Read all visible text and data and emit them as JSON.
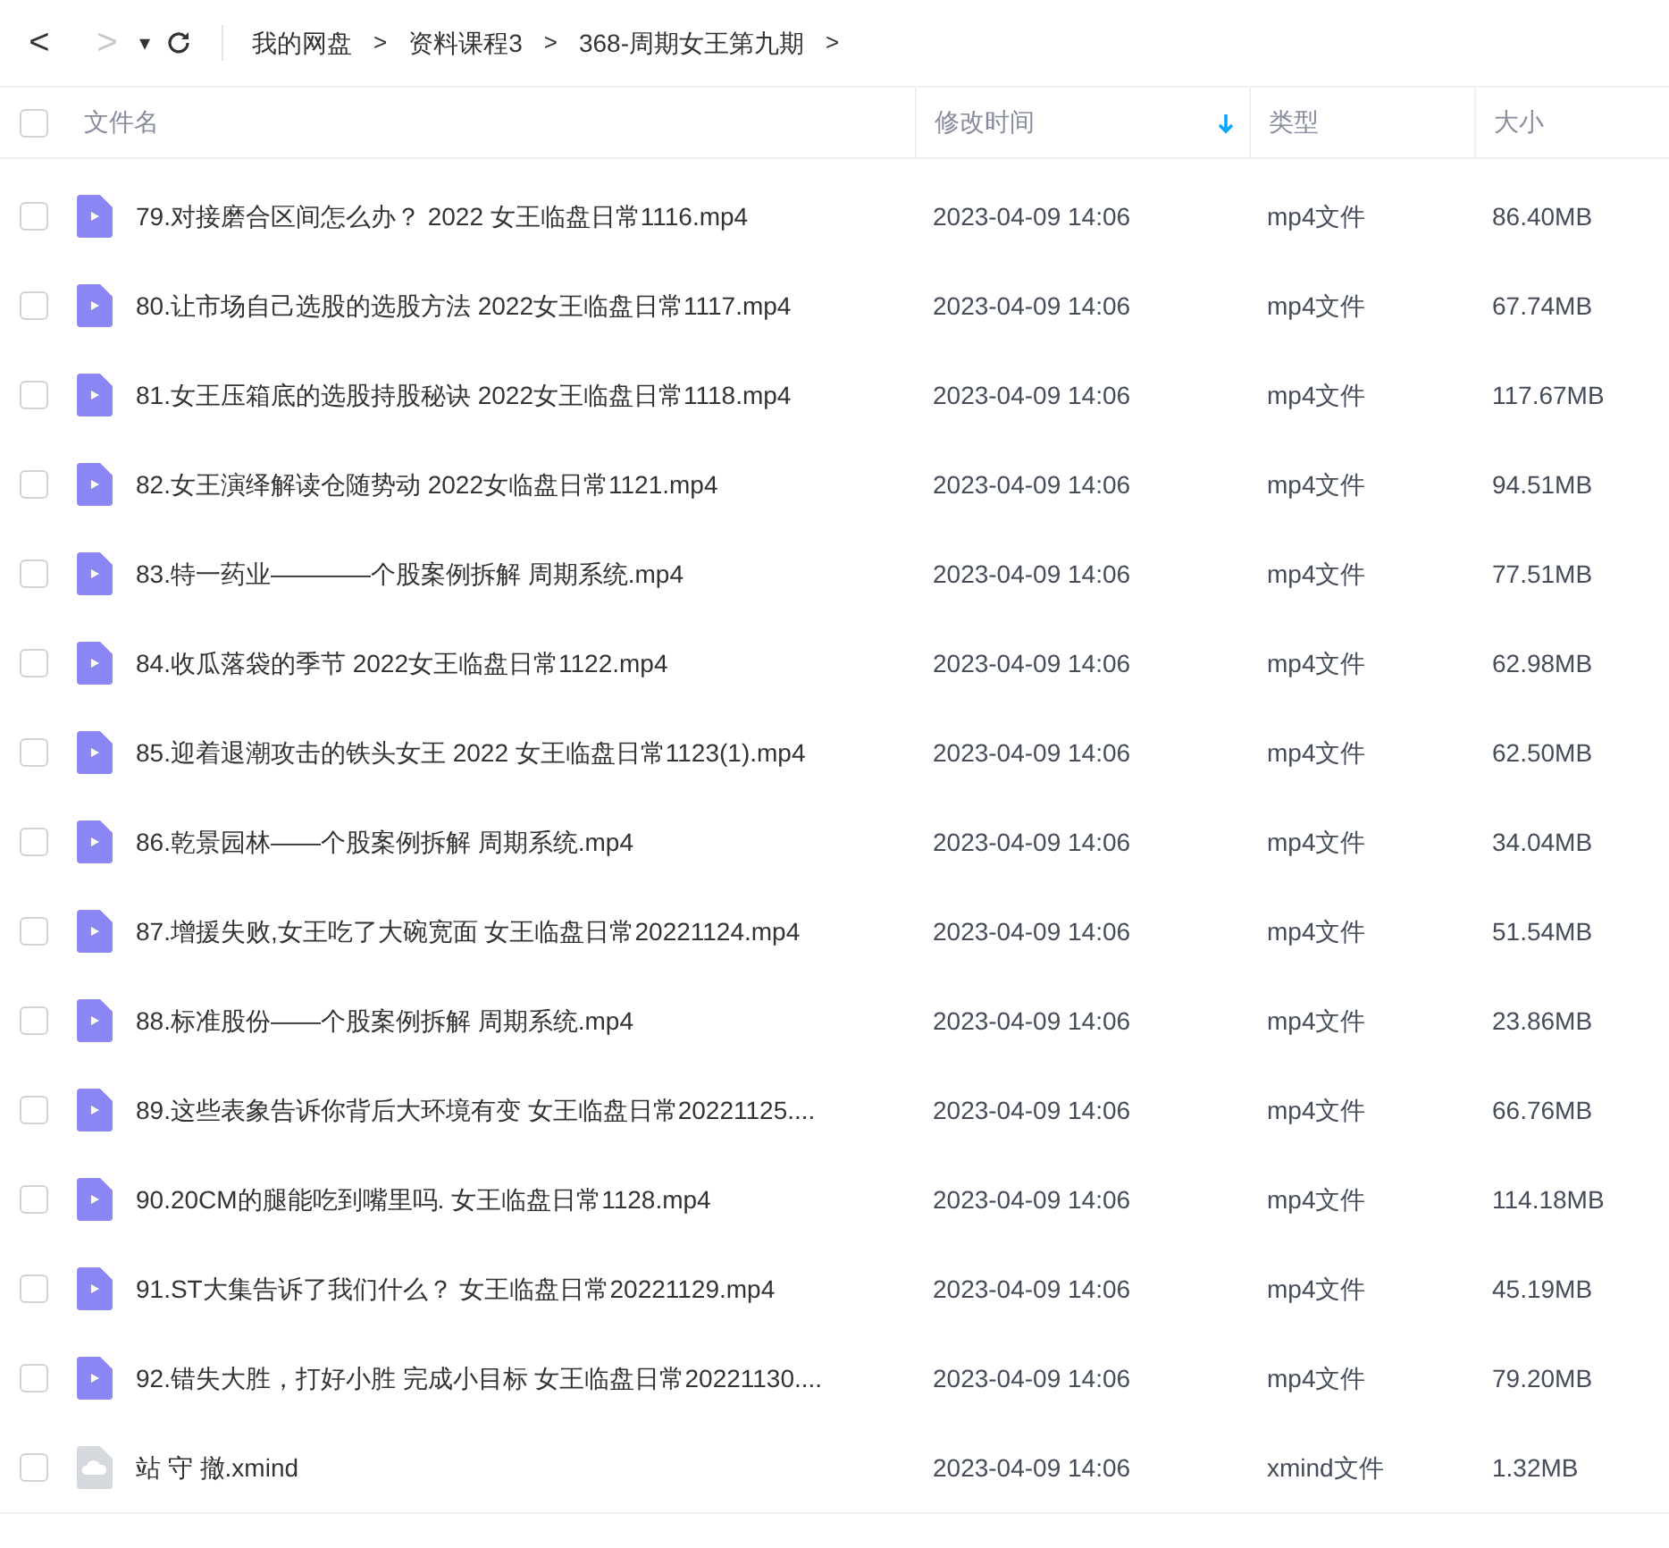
{
  "toolbar": {
    "back": "<",
    "forward": ">",
    "menu": "▾",
    "breadcrumbs": [
      "我的网盘",
      "资料课程3",
      "368-周期女王第九期"
    ],
    "separator": ">"
  },
  "table": {
    "select_all": {
      "checked": false
    },
    "columns": [
      {
        "label": "文件名",
        "sorted": false
      },
      {
        "label": "修改时间",
        "sorted": true
      },
      {
        "label": "类型",
        "sorted": false
      },
      {
        "label": "大小",
        "sorted": false
      }
    ],
    "rows": [
      {
        "kind": "video",
        "checked": false,
        "name": "79.对接磨合区间怎么办？  2022 女王临盘日常1116.mp4",
        "modified": "2023-04-09 14:06",
        "type": "mp4文件",
        "size": "86.40MB"
      },
      {
        "kind": "video",
        "checked": false,
        "name": "80.让市场自己选股的选股方法 2022女王临盘日常1117.mp4",
        "modified": "2023-04-09 14:06",
        "type": "mp4文件",
        "size": "67.74MB"
      },
      {
        "kind": "video",
        "checked": false,
        "name": "81.女王压箱底的选股持股秘诀 2022女王临盘日常1118.mp4",
        "modified": "2023-04-09 14:06",
        "type": "mp4文件",
        "size": "117.67MB"
      },
      {
        "kind": "video",
        "checked": false,
        "name": "82.女王演绎解读仓随势动 2022女临盘日常1121.mp4",
        "modified": "2023-04-09 14:06",
        "type": "mp4文件",
        "size": "94.51MB"
      },
      {
        "kind": "video",
        "checked": false,
        "name": "83.特一药业————个股案例拆解 周期系统.mp4",
        "modified": "2023-04-09 14:06",
        "type": "mp4文件",
        "size": "77.51MB"
      },
      {
        "kind": "video",
        "checked": false,
        "name": "84.收瓜落袋的季节 2022女王临盘日常1122.mp4",
        "modified": "2023-04-09 14:06",
        "type": "mp4文件",
        "size": "62.98MB"
      },
      {
        "kind": "video",
        "checked": false,
        "name": "85.迎着退潮攻击的铁头女王 2022 女王临盘日常1123(1).mp4",
        "modified": "2023-04-09 14:06",
        "type": "mp4文件",
        "size": "62.50MB"
      },
      {
        "kind": "video",
        "checked": false,
        "name": "86.乾景园林——个股案例拆解 周期系统.mp4",
        "modified": "2023-04-09 14:06",
        "type": "mp4文件",
        "size": "34.04MB"
      },
      {
        "kind": "video",
        "checked": false,
        "name": "87.增援失败,女王吃了大碗宽面 女王临盘日常20221124.mp4",
        "modified": "2023-04-09 14:06",
        "type": "mp4文件",
        "size": "51.54MB"
      },
      {
        "kind": "video",
        "checked": false,
        "name": "88.标准股份——个股案例拆解 周期系统.mp4",
        "modified": "2023-04-09 14:06",
        "type": "mp4文件",
        "size": "23.86MB"
      },
      {
        "kind": "video",
        "checked": false,
        "name": "89.这些表象告诉你背后大环境有变 女王临盘日常20221125....",
        "modified": "2023-04-09 14:06",
        "type": "mp4文件",
        "size": "66.76MB"
      },
      {
        "kind": "video",
        "checked": false,
        "name": "90.20CM的腿能吃到嘴里吗. 女王临盘日常1128.mp4",
        "modified": "2023-04-09 14:06",
        "type": "mp4文件",
        "size": "114.18MB"
      },
      {
        "kind": "video",
        "checked": false,
        "name": "91.ST大集告诉了我们什么？  女王临盘日常20221129.mp4",
        "modified": "2023-04-09 14:06",
        "type": "mp4文件",
        "size": "45.19MB"
      },
      {
        "kind": "video",
        "checked": false,
        "name": "92.错失大胜，打好小胜 完成小目标 女王临盘日常20221130....",
        "modified": "2023-04-09 14:06",
        "type": "mp4文件",
        "size": "79.20MB"
      },
      {
        "kind": "mindmap",
        "checked": false,
        "name": "站 守 撤.xmind",
        "modified": "2023-04-09 14:06",
        "type": "xmind文件",
        "size": "1.32MB"
      }
    ]
  }
}
